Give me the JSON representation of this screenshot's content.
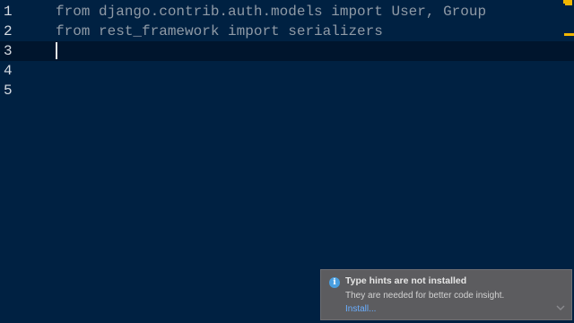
{
  "editor": {
    "lines": [
      {
        "number": "1",
        "code": "from django.contrib.auth.models import User, Group"
      },
      {
        "number": "2",
        "code": "from rest_framework import serializers"
      },
      {
        "number": "3",
        "code": ""
      },
      {
        "number": "4",
        "code": ""
      },
      {
        "number": "5",
        "code": ""
      }
    ],
    "current_line": 3
  },
  "notification": {
    "icon": "info-icon",
    "title": "Type hints are not installed",
    "body": "They are needed for better code insight.",
    "action_label": "Install...",
    "expand_icon": "chevron-down-icon"
  },
  "colors": {
    "editor_background": "#002142",
    "current_line_background": "#00152d",
    "code_text": "#8f9aa6",
    "line_number": "#d6dbe2",
    "marker": "#f2b600",
    "notification_background": "#5c5c5f",
    "link": "#6aaeff",
    "info_icon": "#4a9fe0"
  }
}
